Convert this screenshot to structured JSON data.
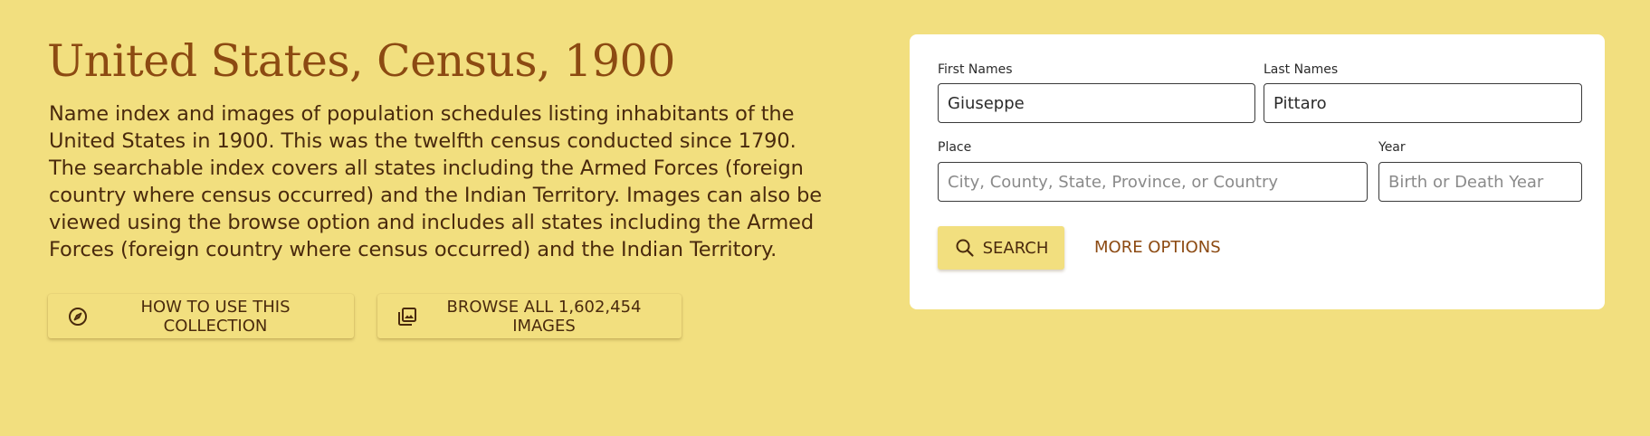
{
  "collection": {
    "title": "United States, Census, 1900",
    "description": "Name index and images of population schedules listing inhabitants of the United States in 1900. This was the twelfth census conducted since 1790. The searchable index covers all states including the Armed Forces (foreign country where census occurred) and the Indian Territory. Images can also be viewed using the browse option and includes all states including the Armed Forces (foreign country where census occurred) and the Indian Territory."
  },
  "actions": {
    "how_to_use": {
      "label": "HOW TO USE THIS COLLECTION",
      "icon": "compass-icon"
    },
    "browse": {
      "label": "BROWSE ALL 1,602,454 IMAGES",
      "icon": "image-library-icon"
    }
  },
  "search": {
    "first_names": {
      "label": "First Names",
      "value": "Giuseppe",
      "placeholder": ""
    },
    "last_names": {
      "label": "Last Names",
      "value": "Pittaro",
      "placeholder": ""
    },
    "place": {
      "label": "Place",
      "value": "",
      "placeholder": "City, County, State, Province, or Country"
    },
    "year": {
      "label": "Year",
      "value": "",
      "placeholder": "Birth or Death Year"
    },
    "search_button": {
      "label": "SEARCH",
      "icon": "search-icon"
    },
    "more_options": {
      "label": "MORE OPTIONS"
    }
  },
  "colors": {
    "background": "#f2df7f",
    "title": "#8c4a12",
    "text": "#4a2a0d",
    "card": "#ffffff",
    "link": "#8c4a12"
  }
}
